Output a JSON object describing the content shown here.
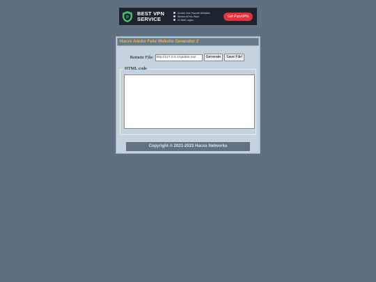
{
  "ad": {
    "title_line1": "BEST VPN",
    "title_line2": "SERVICE",
    "features": [
      "Access Your Favorite Websites",
      "Stream All You Want",
      "10 Multi Logins"
    ],
    "cta": "Get PureVPN"
  },
  "panel": {
    "title": "Hacxx Adobe Fake Website Generator 2",
    "remote_file_label": "Remote File:",
    "remote_file_value": "http://127.0.0.1/update.exe",
    "generate_label": "Generate",
    "save_label": "Save File!",
    "html_code_legend": "HTML code",
    "html_code_value": "",
    "copyright": "Copyright © 2021-2023 Hacxx Networks"
  },
  "colors": {
    "background": "#5f7080",
    "panel": "#c4d3de",
    "title_text": "#f2b33b",
    "cta": "#e8303b"
  }
}
